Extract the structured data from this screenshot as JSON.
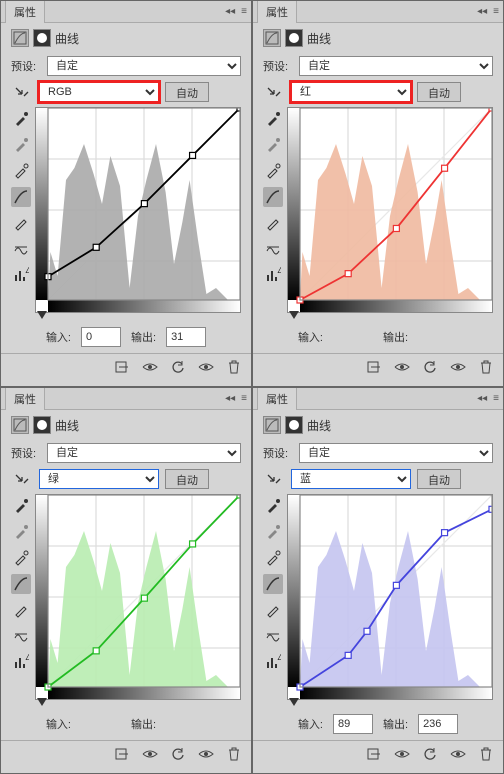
{
  "panel_title": "属性",
  "curves_label": "曲线",
  "preset_label": "预设:",
  "preset_value": "自定",
  "auto_label": "自动",
  "input_label": "输入:",
  "output_label": "输出:",
  "panels": {
    "rgb": {
      "channel": "RGB",
      "highlight": true,
      "input": "0",
      "output": "31",
      "color": "#000",
      "hist": "#aaa"
    },
    "red": {
      "channel": "红",
      "highlight": true,
      "input": "",
      "output": "",
      "color": "#e33",
      "hist": "#f0b9a0"
    },
    "green": {
      "channel": "绿",
      "highlight": false,
      "input": "",
      "output": "",
      "color": "#2b2",
      "hist": "#b8ecb0"
    },
    "blue": {
      "channel": "蓝",
      "highlight": false,
      "input": "89",
      "output": "236",
      "color": "#44d",
      "hist": "#c4c4f0"
    }
  },
  "chart_data": [
    {
      "type": "line",
      "title": "RGB",
      "x": [
        0,
        64,
        128,
        192,
        255
      ],
      "y": [
        31,
        70,
        128,
        192,
        255
      ],
      "xlim": [
        0,
        255
      ],
      "ylim": [
        0,
        255
      ]
    },
    {
      "type": "line",
      "title": "红",
      "x": [
        0,
        64,
        128,
        192,
        255
      ],
      "y": [
        0,
        35,
        95,
        175,
        255
      ],
      "xlim": [
        0,
        255
      ],
      "ylim": [
        0,
        255
      ]
    },
    {
      "type": "line",
      "title": "绿",
      "x": [
        0,
        64,
        128,
        192,
        255
      ],
      "y": [
        0,
        48,
        118,
        190,
        255
      ],
      "xlim": [
        0,
        255
      ],
      "ylim": [
        0,
        255
      ]
    },
    {
      "type": "line",
      "title": "蓝",
      "x": [
        0,
        64,
        89,
        128,
        192,
        255
      ],
      "y": [
        0,
        42,
        74,
        135,
        205,
        236
      ],
      "xlim": [
        0,
        255
      ],
      "ylim": [
        0,
        255
      ]
    }
  ]
}
